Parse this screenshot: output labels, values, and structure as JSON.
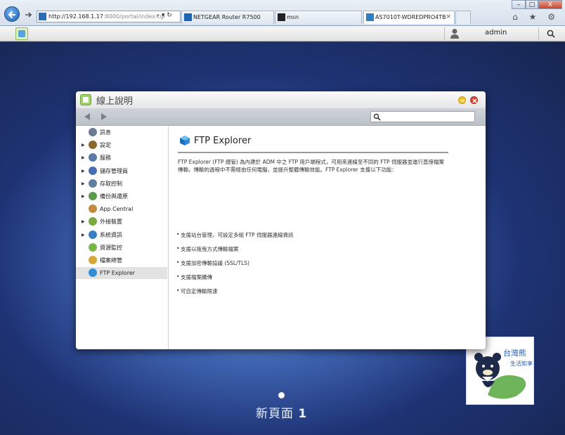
{
  "browser": {
    "address_url": "http://192.168.1.17:8000/portal/index.cgi",
    "address_url_host": "http://192.168.1.17",
    "address_url_rest": ":8000/portal/index.cgi",
    "address_tools": "⌕ ▾ ↻",
    "tabs": [
      {
        "label": "NETGEAR Router R7500"
      },
      {
        "label": "msn"
      },
      {
        "label": "AS7010T-WDREDPRO4TB"
      }
    ],
    "close_tab": "×",
    "window_controls": {
      "minimize": "–",
      "maximize": "□",
      "close": "X"
    },
    "command_icons": "⌂ ★ ⚙"
  },
  "adm": {
    "user_name": "admin",
    "search_icon": "search-icon"
  },
  "help_window": {
    "title": "線上說明",
    "sidebar": {
      "items": [
        {
          "label": "訊息",
          "icon": "info-icon",
          "has_arrow": false,
          "color": "#6b7c93"
        },
        {
          "label": "設定",
          "icon": "gear-icon",
          "has_arrow": true,
          "color": "#8a6a2a"
        },
        {
          "label": "服務",
          "icon": "services-icon",
          "has_arrow": true,
          "color": "#5a7aa8"
        },
        {
          "label": "儲存管理員",
          "icon": "storage-icon",
          "has_arrow": true,
          "color": "#4a6fb5"
        },
        {
          "label": "存取控制",
          "icon": "access-control-icon",
          "has_arrow": true,
          "color": "#5d7f9e"
        },
        {
          "label": "備份與還原",
          "icon": "backup-icon",
          "has_arrow": true,
          "color": "#5b9b4b"
        },
        {
          "label": "App Central",
          "icon": "app-central-icon",
          "has_arrow": false,
          "color": "#c28a3a"
        },
        {
          "label": "外接裝置",
          "icon": "external-device-icon",
          "has_arrow": true,
          "color": "#79a83e"
        },
        {
          "label": "系統資訊",
          "icon": "system-info-icon",
          "has_arrow": true,
          "color": "#3b7fc4"
        },
        {
          "label": "資源監控",
          "icon": "resource-monitor-icon",
          "has_arrow": false,
          "color": "#7ab548"
        },
        {
          "label": "檔案總管",
          "icon": "file-explorer-icon",
          "has_arrow": false,
          "color": "#d8a634"
        },
        {
          "label": "FTP Explorer",
          "icon": "ftp-explorer-icon",
          "has_arrow": false,
          "color": "#2f8ed6",
          "selected": true
        }
      ]
    },
    "content": {
      "title": "FTP Explorer",
      "intro": "FTP Explorer (FTP 總管) 為內建於 ADM 中之 FTP 用戶端程式，可用來連線至不同的 FTP 伺服器並進行直接檔案傳輸，傳輸的過程中不需經由任何電腦，並提升整體傳輸效能。FTP Explorer 支援以下功能：",
      "features": [
        "支援站台管理，可設定多組 FTP 伺服器連線資訊",
        "支援以拖曳方式傳輸檔案",
        "支援加密傳輸協議 (SSL/TLS)",
        "支援檔案續傳",
        "可自定傳輸限速"
      ]
    }
  },
  "desktop": {
    "page_label": "新頁面",
    "page_number": "1"
  }
}
